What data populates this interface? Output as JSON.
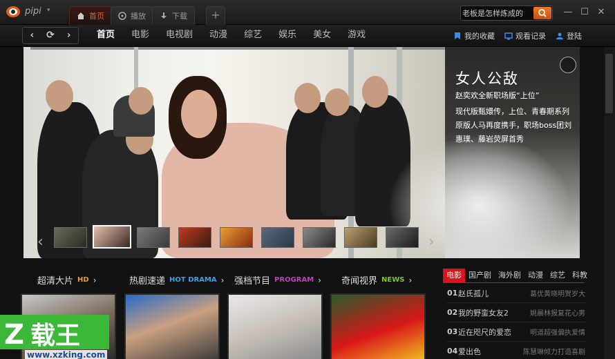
{
  "app": {
    "brand": "pipi"
  },
  "tabs": [
    {
      "label": "首页",
      "active": true
    },
    {
      "label": "播放",
      "active": false
    },
    {
      "label": "下载",
      "active": false
    }
  ],
  "search": {
    "placeholder": "老板是怎样炼成的"
  },
  "nav": {
    "links": [
      "首页",
      "电影",
      "电视剧",
      "动漫",
      "综艺",
      "娱乐",
      "美女",
      "游戏"
    ],
    "active_index": 0,
    "favorites": "我的收藏",
    "history": "观看记录",
    "login": "登陆"
  },
  "banner": {
    "title": "女人公敌",
    "subtitle": "赵奕欢全新职场版“上位”",
    "description": "现代版甄嬛传，上位、青春期系列原版人马再度携手，职场boss团刘惠璞、藤岩荧屏首秀"
  },
  "sections": [
    {
      "title": "超清大片",
      "tag": "HD",
      "tag_color": "#e8a020"
    },
    {
      "title": "热剧速递",
      "tag": "HOT DRAMA",
      "tag_color": "#3aa0e8"
    },
    {
      "title": "强档节目",
      "tag": "PROGRAM",
      "tag_color": "#c040c0"
    },
    {
      "title": "奇闻视界",
      "tag": "NEWS",
      "tag_color": "#7ac820"
    }
  ],
  "ranking": {
    "tabs": [
      "电影",
      "国产剧",
      "海外剧",
      "动漫",
      "综艺",
      "科教"
    ],
    "items": [
      {
        "num": "01",
        "title": "赵氏孤儿",
        "desc": "葛优黄晓明贺岁大"
      },
      {
        "num": "02",
        "title": "我的野蛮女友2",
        "desc": "姚晨林报复花心男"
      },
      {
        "num": "03",
        "title": "近在咫尺的爱恋",
        "desc": "明道超强偏执爱情"
      },
      {
        "num": "04",
        "title": "爱出色",
        "desc": "陈慧琳倾力打造喜剧"
      }
    ]
  },
  "watermark": {
    "text": "载王",
    "url": "www.xzking.com"
  },
  "colors": {
    "accent": "#e8641c",
    "rank_red": "#d7151b"
  }
}
